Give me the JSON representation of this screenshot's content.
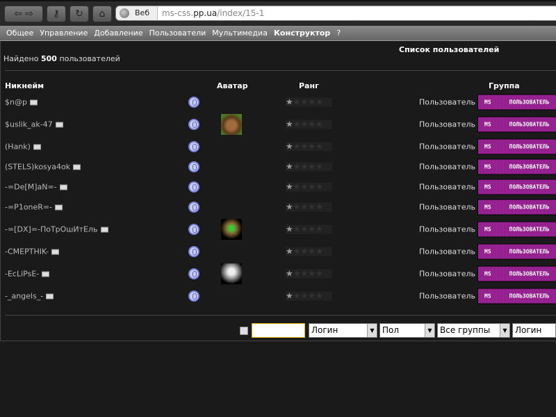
{
  "browser": {
    "web_label": "Веб",
    "url_host_prefix": "ms-css.",
    "url_host": "pp.ua",
    "url_path": "/index/15-1"
  },
  "nav": [
    "Общее",
    "Управление",
    "Добавление",
    "Пользователи",
    "Мультимедиа",
    "Конструктор",
    "?"
  ],
  "nav_active": "Конструктор",
  "page": {
    "title": "Список пользователей",
    "found_prefix": "Найдено",
    "found_count": "500",
    "found_suffix": "пользователей"
  },
  "columns": {
    "nick": "Никнейм",
    "avatar": "Аватар",
    "rank": "Ранг",
    "group": "Группа"
  },
  "users": [
    {
      "nick": "$n@p",
      "avatar": false,
      "rank": 1,
      "group": "Пользователь",
      "badge_ms": "MS",
      "badge_text": "пользователь"
    },
    {
      "nick": "$uslik_ak-47",
      "avatar": "squirrel",
      "rank": 1,
      "group": "Пользователь",
      "badge_ms": "MS",
      "badge_text": "пользователь"
    },
    {
      "nick": "(Hank)",
      "avatar": false,
      "rank": 1,
      "group": "Пользователь",
      "badge_ms": "MS",
      "badge_text": "пользователь"
    },
    {
      "nick": "(STELS)kosya4ok",
      "avatar": false,
      "rank": 1,
      "group": "Пользователь",
      "badge_ms": "MS",
      "badge_text": "пользователь"
    },
    {
      "nick": "-=De[M]aN=-",
      "avatar": false,
      "rank": 1,
      "group": "Пользователь",
      "badge_ms": "MS",
      "badge_text": "пользователь"
    },
    {
      "nick": "-=P1oneR=-",
      "avatar": false,
      "rank": 1,
      "group": "Пользователь",
      "badge_ms": "MS",
      "badge_text": "пользователь"
    },
    {
      "nick": "-=[DX]=-ПоТрОшИтЕль",
      "avatar": "dx",
      "rank": 1,
      "group": "Пользователь",
      "badge_ms": "MS",
      "badge_text": "пользователь"
    },
    {
      "nick": "-CMEPTHIK-",
      "avatar": false,
      "rank": 1,
      "group": "Пользователь",
      "badge_ms": "MS",
      "badge_text": "пользователь"
    },
    {
      "nick": "-EcLiPsE-",
      "avatar": "einstein",
      "rank": 1,
      "group": "Пользователь",
      "badge_ms": "MS",
      "badge_text": "пользователь"
    },
    {
      "nick": "-_angels_-",
      "avatar": false,
      "rank": 1,
      "group": "Пользователь",
      "badge_ms": "MS",
      "badge_text": "пользователь"
    }
  ],
  "filters": {
    "search_value": "",
    "field1": "Логин",
    "gender": "Пол",
    "groups": "Все группы",
    "sort": "Логин"
  }
}
